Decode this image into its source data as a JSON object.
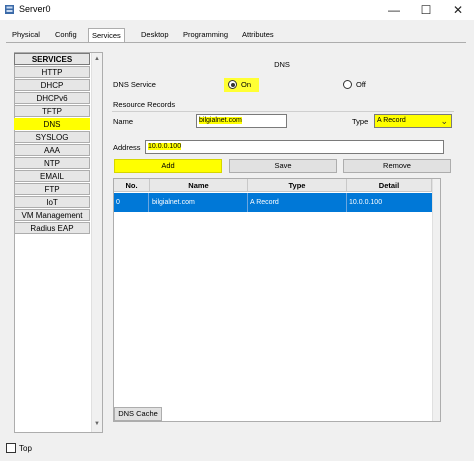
{
  "window": {
    "title": "Server0",
    "minimize_glyph": "—",
    "maximize_glyph": "☐",
    "close_glyph": "✕",
    "icon": "server-app-icon"
  },
  "tabs": [
    {
      "label": "Physical"
    },
    {
      "label": "Config"
    },
    {
      "label": "Services",
      "active": true
    },
    {
      "label": "Desktop"
    },
    {
      "label": "Programming"
    },
    {
      "label": "Attributes"
    }
  ],
  "services": {
    "header": "SERVICES",
    "items": [
      {
        "label": "HTTP"
      },
      {
        "label": "DHCP"
      },
      {
        "label": "DHCPv6"
      },
      {
        "label": "TFTP"
      },
      {
        "label": "DNS",
        "active": true
      },
      {
        "label": "SYSLOG"
      },
      {
        "label": "AAA"
      },
      {
        "label": "NTP"
      },
      {
        "label": "EMAIL"
      },
      {
        "label": "FTP"
      },
      {
        "label": "IoT"
      },
      {
        "label": "VM Management"
      },
      {
        "label": "Radius EAP"
      }
    ]
  },
  "dns": {
    "section_title": "DNS",
    "service_label": "DNS Service",
    "on_label": "On",
    "off_label": "Off",
    "service_state": "on",
    "records_label": "Resource Records",
    "name_label": "Name",
    "name_value": "bilgialnet.com",
    "type_label": "Type",
    "type_value": "A Record",
    "address_label": "Address",
    "address_value": "10.0.0.100",
    "add_button": "Add",
    "save_button": "Save",
    "remove_button": "Remove",
    "table": {
      "columns": [
        "No.",
        "Name",
        "Type",
        "Detail"
      ],
      "rows": [
        {
          "no": "0",
          "name": "bilgialnet.com",
          "type": "A Record",
          "detail": "10.0.0.100"
        }
      ]
    },
    "cache_button": "DNS Cache"
  },
  "footer": {
    "top_label": "Top"
  },
  "colors": {
    "highlight": "#ffff00",
    "selection": "#0078d7"
  }
}
